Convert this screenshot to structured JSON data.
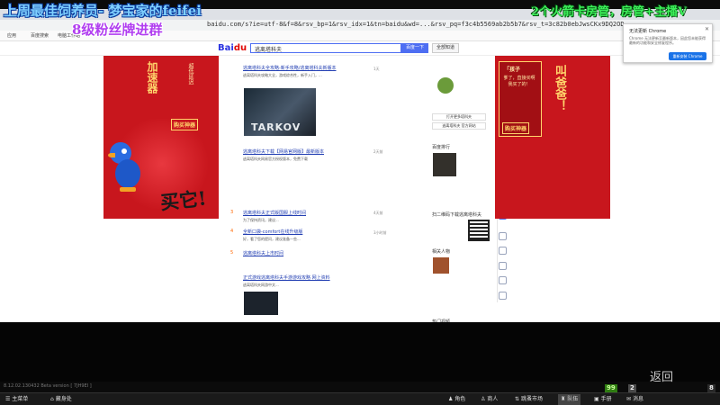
{
  "overlay": {
    "line1": "上周最佳饲养员- 梦宝家的feifei",
    "line2": "2个火箭卡房管，房管+主播V",
    "line3": "8级粉丝牌进群"
  },
  "browser": {
    "url": "baidu.com/s?ie=utf-8&f=8&rsv_bp=1&rsv_idx=1&tn=baidu&wd=...&rsv_pq=f3c4b5569ab2b5b7&rsv_t=3c82b0ebJwsCKx9DQ2OD",
    "bookmarks": [
      "应用",
      "百度搜索",
      "电脑工作站"
    ],
    "search_value": "逃离塔科夫",
    "search_button": "百度一下",
    "search_button2": "全部知道"
  },
  "ads": {
    "left_vert1": "加速器",
    "left_vert2": "超低延迟",
    "left_tag": "购买神器",
    "left_big": "买它!",
    "right_panel_title": "「孩子",
    "right_panel_text": "爹了，直接买啊我买了的！",
    "right_vert": "叫爸爸！",
    "right_tag": "购买神器"
  },
  "results": [
    {
      "num": "",
      "title": "逃离塔科夫全攻略-新手攻略/逃离塔科夫新版本",
      "desc": "逃离塔科夫攻略大全，游戏综合性，新手入门，...",
      "meta": "1天"
    },
    {
      "num": "",
      "title": "逃离塔科夫下载【网易官网版】最新版本",
      "desc": "逃离塔科夫网易官方授权版本，免费下载",
      "meta": "2天前"
    },
    {
      "num": "3",
      "title": "逃离塔科夫正式版国服上线时间",
      "desc": "为了保持资讯，建议...",
      "meta": "4天前"
    },
    {
      "num": "4",
      "title": "全新口袋-comfort在线升级版",
      "desc": "好，看了您的提问，建议准备一些...",
      "meta": "3小时前"
    },
    {
      "num": "5",
      "title": "逃离塔科夫上市时间",
      "desc": "",
      "meta": ""
    },
    {
      "num": "",
      "title": "正式游戏逃离塔科夫手游游戏攻略 网上资料",
      "desc": "逃离塔科夫网游中文...",
      "meta": ""
    }
  ],
  "thumb_label": "TARKOV",
  "side": {
    "rank_title": "百度排行",
    "btn1": "打开更多塔科夫",
    "btn2": "逃离塔科夫 官方网站",
    "people_title": "相关人物",
    "qr_label": "扫二维码下载逃离塔科夫",
    "more_label": "热门视频"
  },
  "chrome_popup": {
    "title": "无法更新 Chrome",
    "text": "Chrome 无法更新至最新版本，因此您未能获得最新的功能和安全修复程序。",
    "button": "重新安装 Chrome"
  },
  "bottom": {
    "version": "8.12.02.130432 Beta version [ 7JH9EI ]",
    "back": "返回",
    "badge1": "99",
    "badge2": "2",
    "badge3": "8"
  },
  "taskbar": {
    "items": [
      "主菜单",
      "藏身处",
      "角色",
      "商人",
      "跳蚤市场",
      "队伍",
      "手册",
      "消息"
    ]
  },
  "colors": {
    "ad_red": "#c8161d",
    "baidu_blue": "#4e6ef2",
    "overlay_blue": "#7fd0ff",
    "overlay_green": "#3cf05a",
    "overlay_purple": "#b13ef0"
  }
}
